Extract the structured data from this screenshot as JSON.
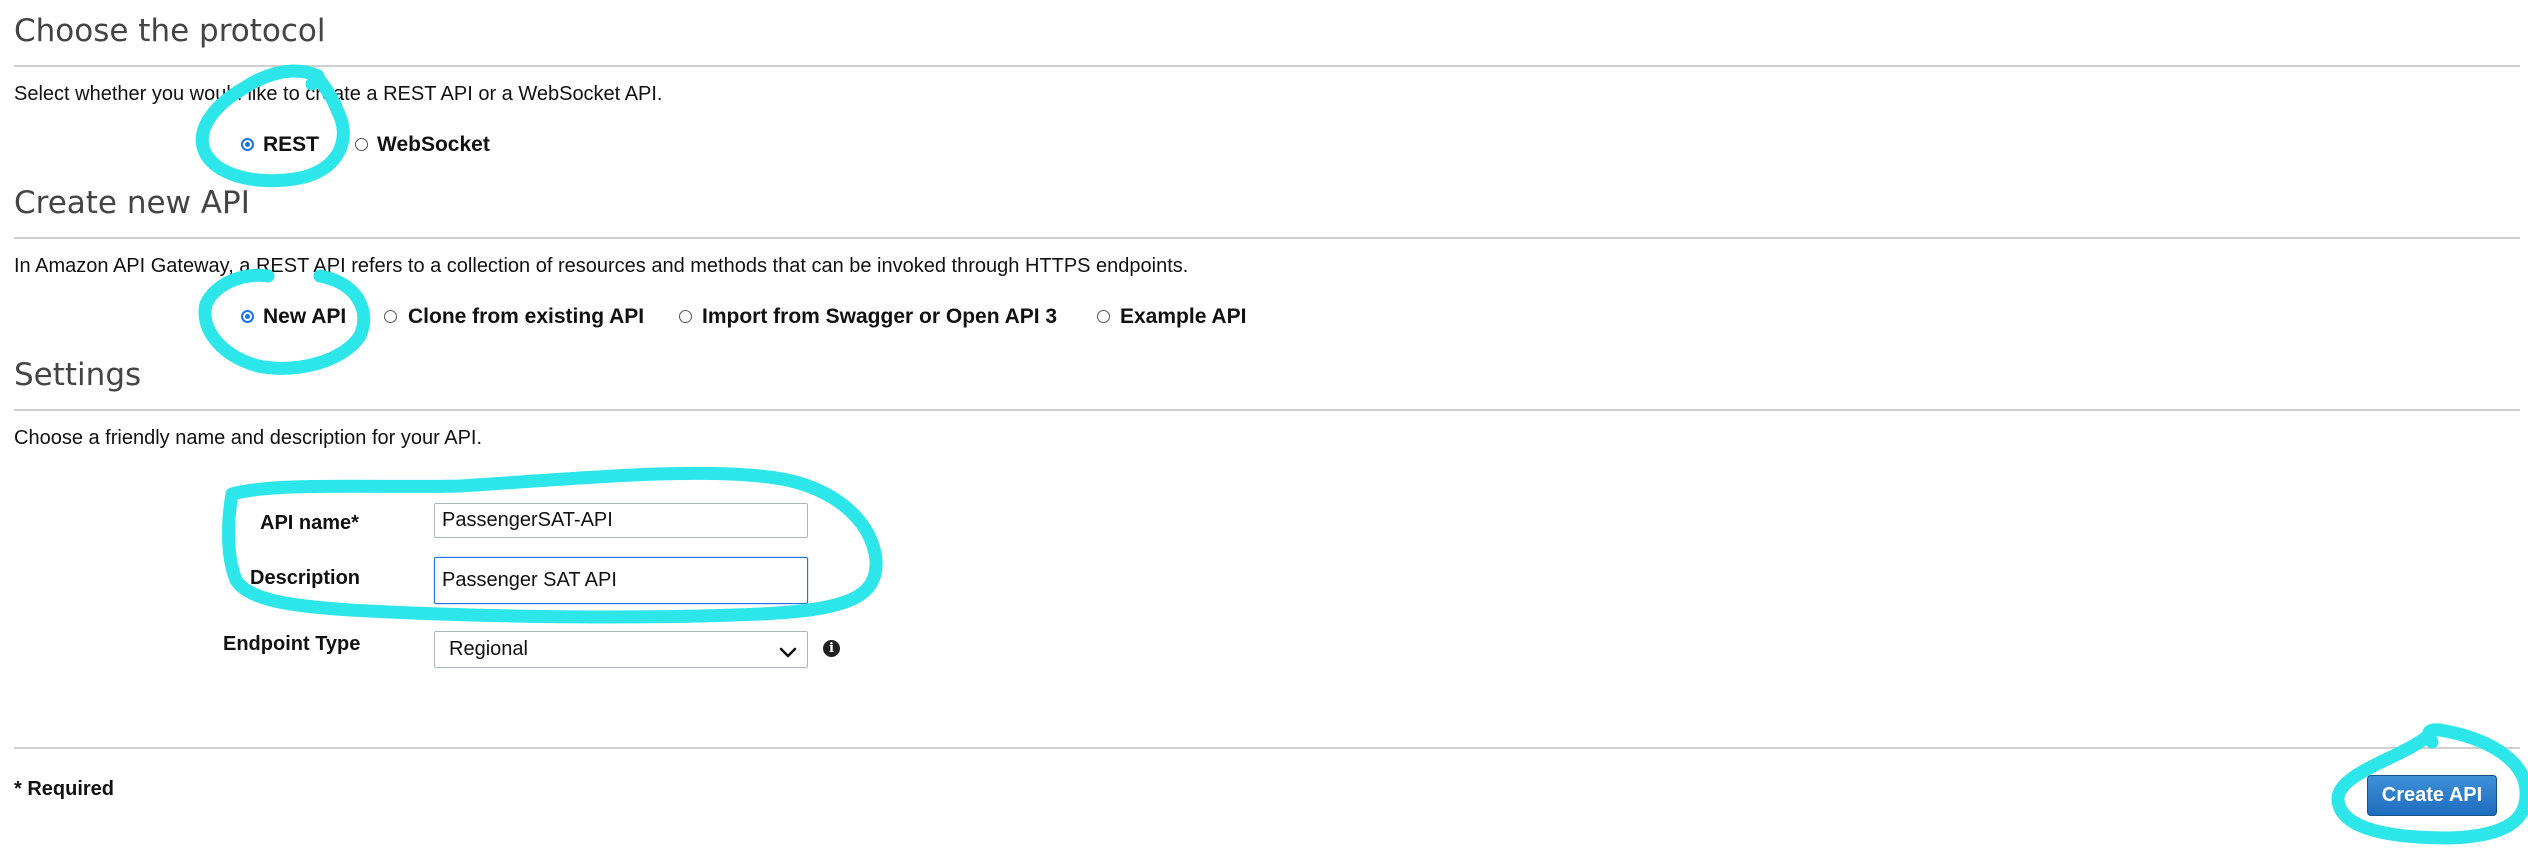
{
  "protocol": {
    "title": "Choose the protocol",
    "description": "Select whether you would like to create a REST API or a WebSocket API.",
    "options": [
      {
        "label": "REST",
        "selected": true
      },
      {
        "label": "WebSocket",
        "selected": false
      }
    ]
  },
  "create_api": {
    "title": "Create new API",
    "description": "In Amazon API Gateway, a REST API refers to a collection of resources and methods that can be invoked through HTTPS endpoints.",
    "options": [
      {
        "label": "New API",
        "selected": true
      },
      {
        "label": "Clone from existing API",
        "selected": false
      },
      {
        "label": "Import from Swagger or Open API 3",
        "selected": false
      },
      {
        "label": "Example API",
        "selected": false
      }
    ]
  },
  "settings": {
    "title": "Settings",
    "description": "Choose a friendly name and description for your API.",
    "api_name": {
      "label": "API name*",
      "value": "PassengerSAT-API"
    },
    "description_field": {
      "label": "Description",
      "value": "Passenger SAT API"
    },
    "endpoint_type": {
      "label": "Endpoint Type",
      "value": "Regional"
    }
  },
  "footer": {
    "required_note": "* Required",
    "create_button": "Create API"
  },
  "colors": {
    "annotation": "#2ce6ea",
    "accent": "#1a73e8",
    "button": "#1f6dbf"
  },
  "icons": {
    "info": "info-icon",
    "chevron": "chevron-down-icon"
  }
}
